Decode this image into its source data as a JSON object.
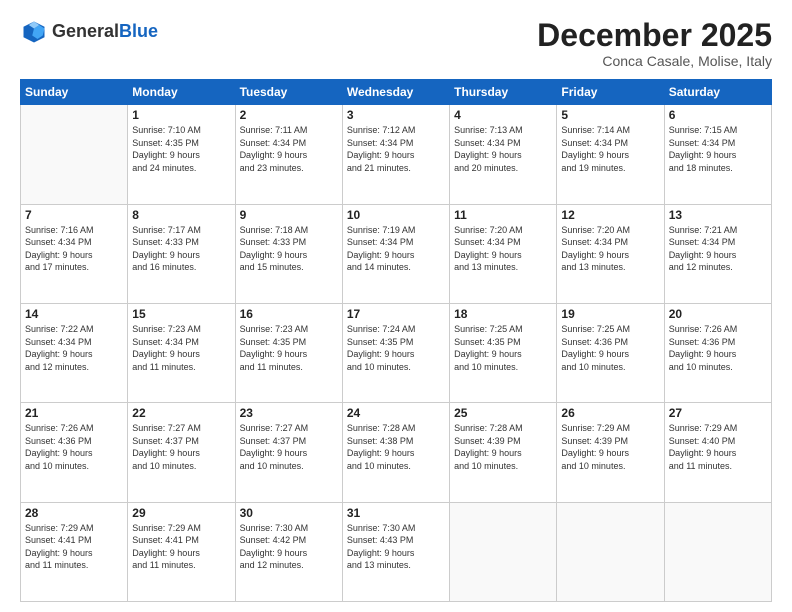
{
  "logo": {
    "general": "General",
    "blue": "Blue"
  },
  "title": "December 2025",
  "location": "Conca Casale, Molise, Italy",
  "days_of_week": [
    "Sunday",
    "Monday",
    "Tuesday",
    "Wednesday",
    "Thursday",
    "Friday",
    "Saturday"
  ],
  "weeks": [
    [
      {
        "day": "",
        "info": ""
      },
      {
        "day": "1",
        "info": "Sunrise: 7:10 AM\nSunset: 4:35 PM\nDaylight: 9 hours\nand 24 minutes."
      },
      {
        "day": "2",
        "info": "Sunrise: 7:11 AM\nSunset: 4:34 PM\nDaylight: 9 hours\nand 23 minutes."
      },
      {
        "day": "3",
        "info": "Sunrise: 7:12 AM\nSunset: 4:34 PM\nDaylight: 9 hours\nand 21 minutes."
      },
      {
        "day": "4",
        "info": "Sunrise: 7:13 AM\nSunset: 4:34 PM\nDaylight: 9 hours\nand 20 minutes."
      },
      {
        "day": "5",
        "info": "Sunrise: 7:14 AM\nSunset: 4:34 PM\nDaylight: 9 hours\nand 19 minutes."
      },
      {
        "day": "6",
        "info": "Sunrise: 7:15 AM\nSunset: 4:34 PM\nDaylight: 9 hours\nand 18 minutes."
      }
    ],
    [
      {
        "day": "7",
        "info": "Sunrise: 7:16 AM\nSunset: 4:34 PM\nDaylight: 9 hours\nand 17 minutes."
      },
      {
        "day": "8",
        "info": "Sunrise: 7:17 AM\nSunset: 4:33 PM\nDaylight: 9 hours\nand 16 minutes."
      },
      {
        "day": "9",
        "info": "Sunrise: 7:18 AM\nSunset: 4:33 PM\nDaylight: 9 hours\nand 15 minutes."
      },
      {
        "day": "10",
        "info": "Sunrise: 7:19 AM\nSunset: 4:34 PM\nDaylight: 9 hours\nand 14 minutes."
      },
      {
        "day": "11",
        "info": "Sunrise: 7:20 AM\nSunset: 4:34 PM\nDaylight: 9 hours\nand 13 minutes."
      },
      {
        "day": "12",
        "info": "Sunrise: 7:20 AM\nSunset: 4:34 PM\nDaylight: 9 hours\nand 13 minutes."
      },
      {
        "day": "13",
        "info": "Sunrise: 7:21 AM\nSunset: 4:34 PM\nDaylight: 9 hours\nand 12 minutes."
      }
    ],
    [
      {
        "day": "14",
        "info": "Sunrise: 7:22 AM\nSunset: 4:34 PM\nDaylight: 9 hours\nand 12 minutes."
      },
      {
        "day": "15",
        "info": "Sunrise: 7:23 AM\nSunset: 4:34 PM\nDaylight: 9 hours\nand 11 minutes."
      },
      {
        "day": "16",
        "info": "Sunrise: 7:23 AM\nSunset: 4:35 PM\nDaylight: 9 hours\nand 11 minutes."
      },
      {
        "day": "17",
        "info": "Sunrise: 7:24 AM\nSunset: 4:35 PM\nDaylight: 9 hours\nand 10 minutes."
      },
      {
        "day": "18",
        "info": "Sunrise: 7:25 AM\nSunset: 4:35 PM\nDaylight: 9 hours\nand 10 minutes."
      },
      {
        "day": "19",
        "info": "Sunrise: 7:25 AM\nSunset: 4:36 PM\nDaylight: 9 hours\nand 10 minutes."
      },
      {
        "day": "20",
        "info": "Sunrise: 7:26 AM\nSunset: 4:36 PM\nDaylight: 9 hours\nand 10 minutes."
      }
    ],
    [
      {
        "day": "21",
        "info": "Sunrise: 7:26 AM\nSunset: 4:36 PM\nDaylight: 9 hours\nand 10 minutes."
      },
      {
        "day": "22",
        "info": "Sunrise: 7:27 AM\nSunset: 4:37 PM\nDaylight: 9 hours\nand 10 minutes."
      },
      {
        "day": "23",
        "info": "Sunrise: 7:27 AM\nSunset: 4:37 PM\nDaylight: 9 hours\nand 10 minutes."
      },
      {
        "day": "24",
        "info": "Sunrise: 7:28 AM\nSunset: 4:38 PM\nDaylight: 9 hours\nand 10 minutes."
      },
      {
        "day": "25",
        "info": "Sunrise: 7:28 AM\nSunset: 4:39 PM\nDaylight: 9 hours\nand 10 minutes."
      },
      {
        "day": "26",
        "info": "Sunrise: 7:29 AM\nSunset: 4:39 PM\nDaylight: 9 hours\nand 10 minutes."
      },
      {
        "day": "27",
        "info": "Sunrise: 7:29 AM\nSunset: 4:40 PM\nDaylight: 9 hours\nand 11 minutes."
      }
    ],
    [
      {
        "day": "28",
        "info": "Sunrise: 7:29 AM\nSunset: 4:41 PM\nDaylight: 9 hours\nand 11 minutes."
      },
      {
        "day": "29",
        "info": "Sunrise: 7:29 AM\nSunset: 4:41 PM\nDaylight: 9 hours\nand 11 minutes."
      },
      {
        "day": "30",
        "info": "Sunrise: 7:30 AM\nSunset: 4:42 PM\nDaylight: 9 hours\nand 12 minutes."
      },
      {
        "day": "31",
        "info": "Sunrise: 7:30 AM\nSunset: 4:43 PM\nDaylight: 9 hours\nand 13 minutes."
      },
      {
        "day": "",
        "info": ""
      },
      {
        "day": "",
        "info": ""
      },
      {
        "day": "",
        "info": ""
      }
    ]
  ]
}
